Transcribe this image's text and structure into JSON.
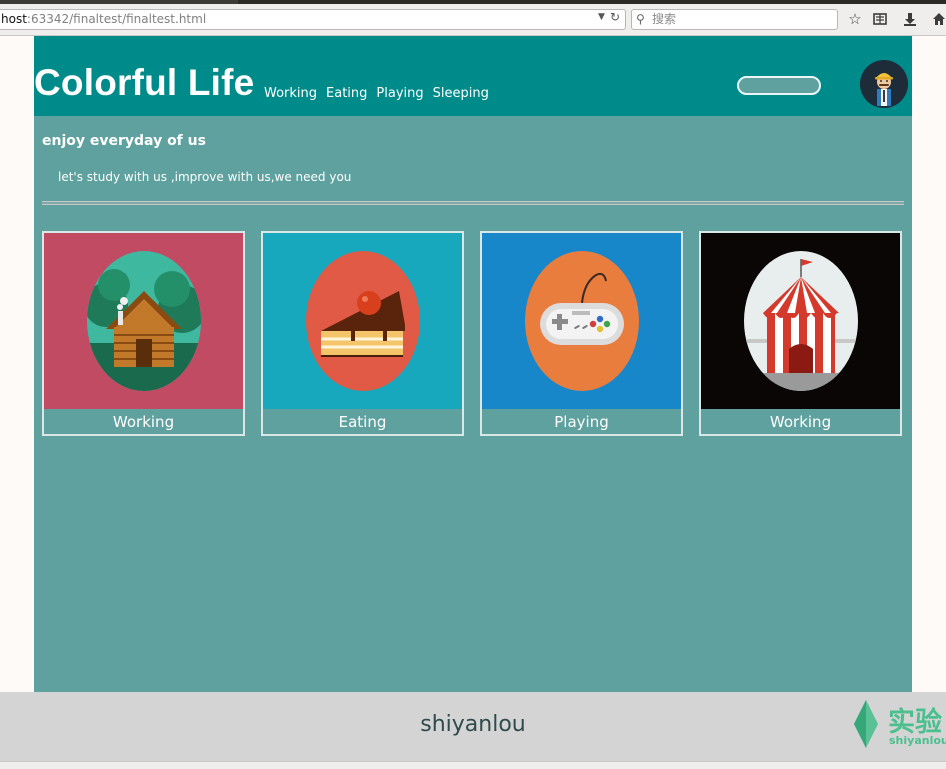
{
  "browser": {
    "url_host": "host",
    "url_path": ":63342/finaltest/finaltest.html",
    "search_placeholder": "搜索",
    "icons": [
      "star-icon",
      "reading-list-icon",
      "download-icon",
      "home-icon"
    ]
  },
  "header": {
    "logo": "Colorful Life",
    "nav": [
      "Working",
      "Eating",
      "Playing",
      "Sleeping"
    ],
    "search_value": ""
  },
  "intro": {
    "title": "enjoy everyday of us",
    "subtitle": "let's study with us ,improve with us,we need you"
  },
  "cards": [
    {
      "label": "Working",
      "bg": "#c04b63",
      "circle": "#3fb8a0",
      "icon": "log-cabin-icon"
    },
    {
      "label": "Eating",
      "bg": "#17a8bd",
      "circle": "#e05a45",
      "icon": "cake-icon"
    },
    {
      "label": "Playing",
      "bg": "#1787c9",
      "circle": "#e87d3e",
      "icon": "gamepad-icon"
    },
    {
      "label": "Working",
      "bg": "#0a0606",
      "circle": "#e8eeee",
      "icon": "circus-tent-icon"
    }
  ],
  "footer": {
    "text": "shiyanlou",
    "logo_cn": "实验",
    "logo_en": "shiyanlou"
  },
  "colors": {
    "page_bg": "#5fa19f",
    "header_bg": "#008b8b",
    "footer_bg": "#d4d4d4"
  }
}
